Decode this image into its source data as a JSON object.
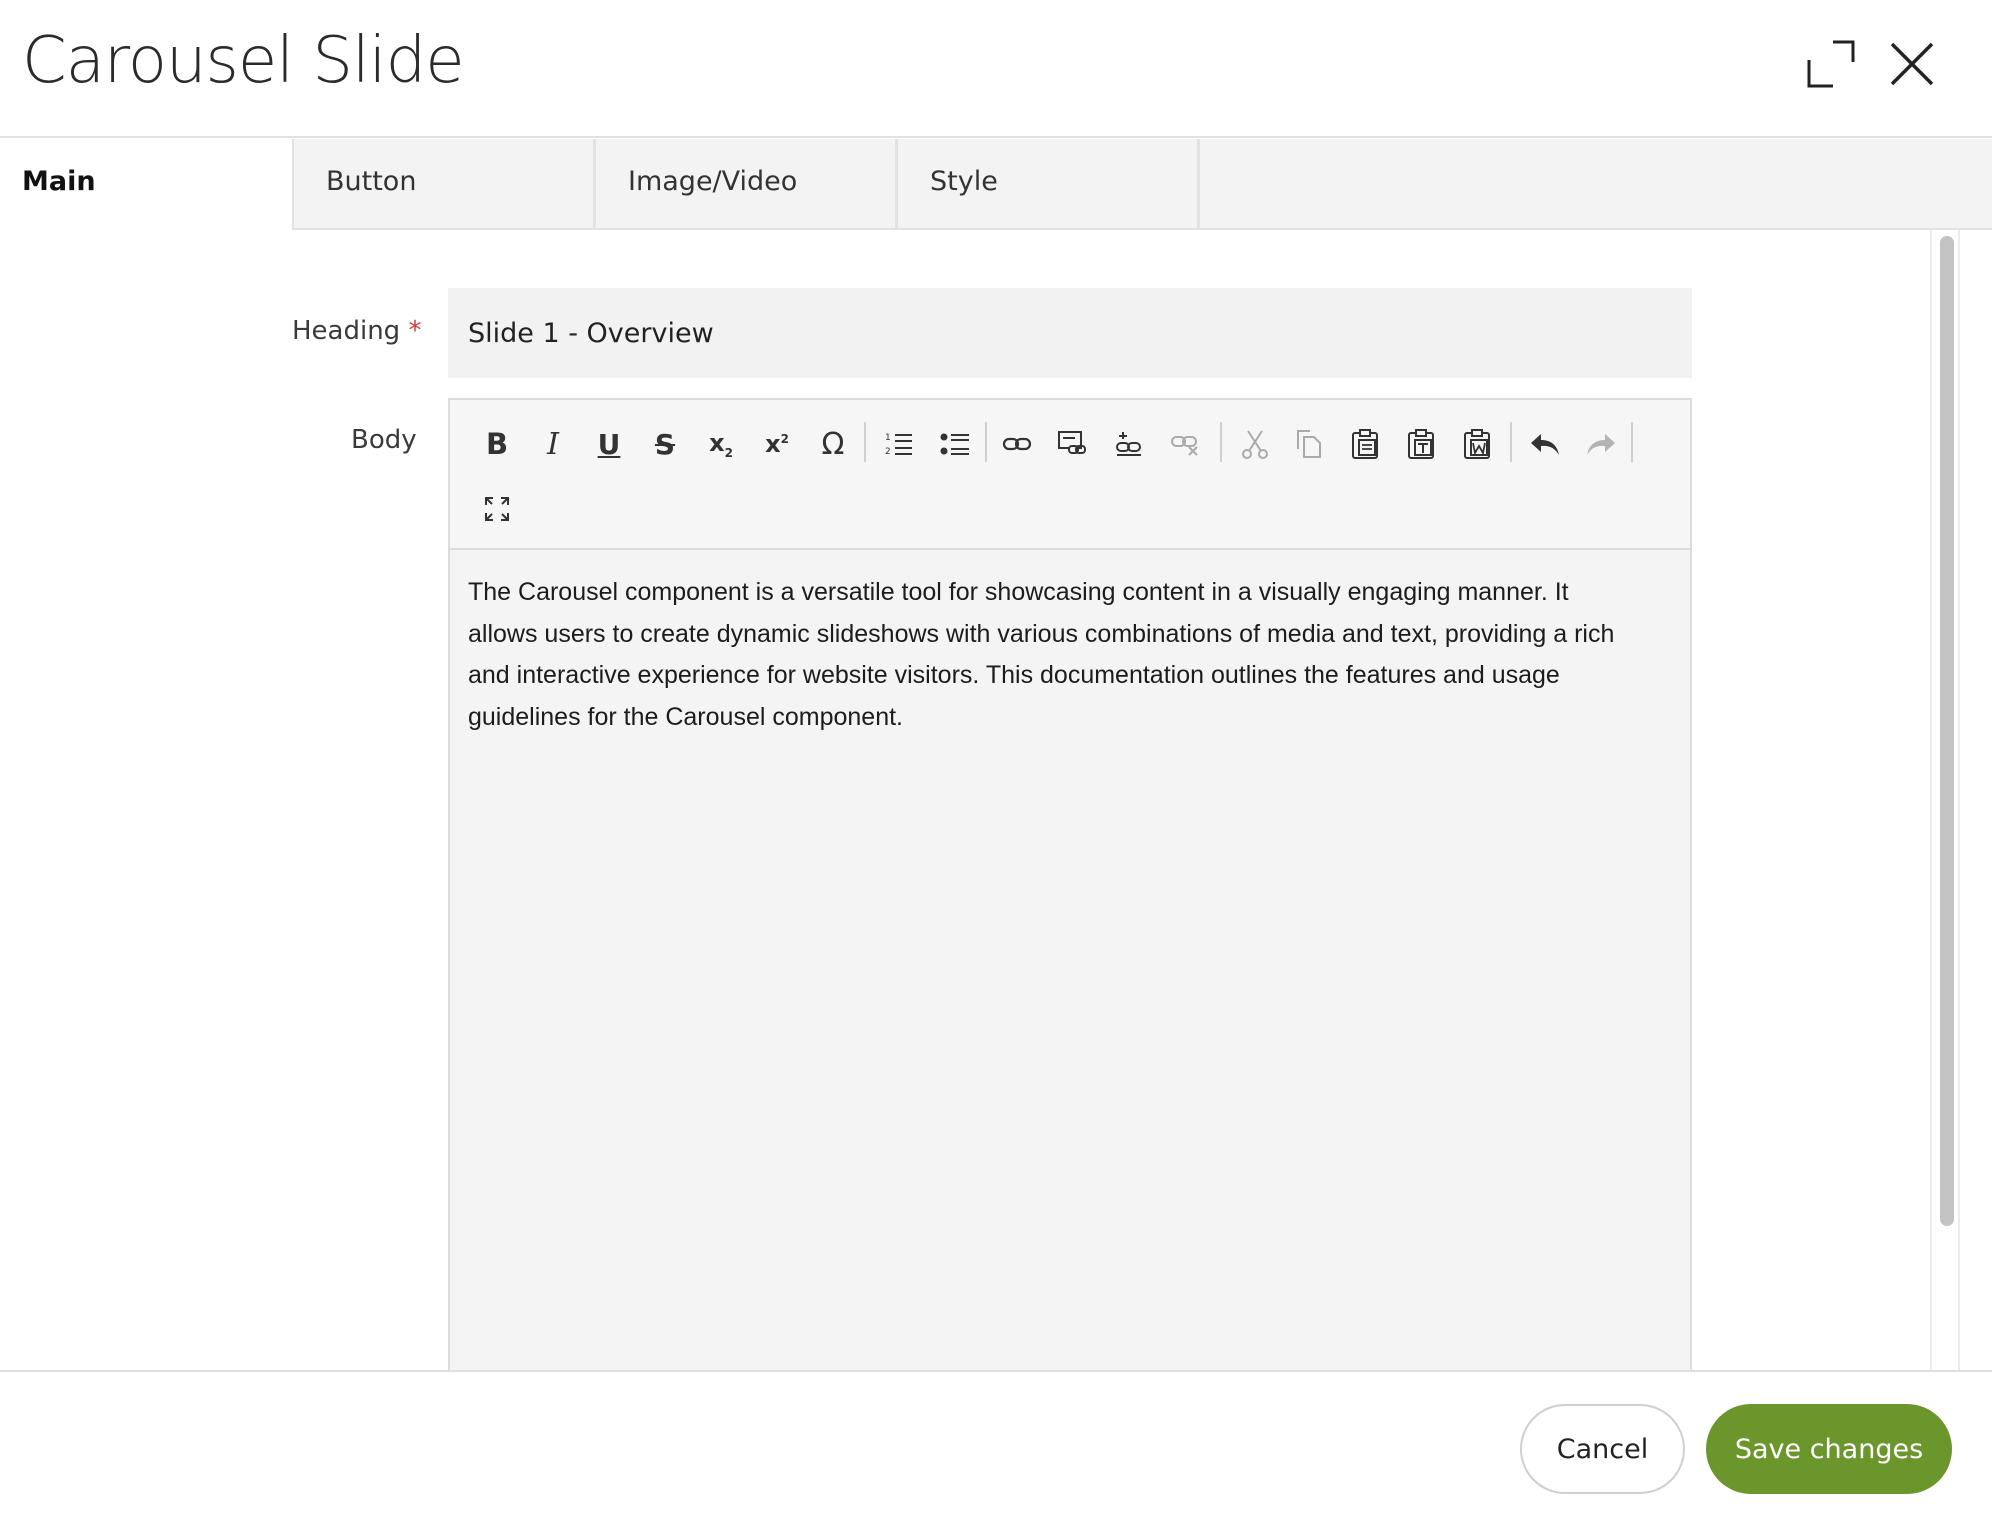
{
  "dialog": {
    "title": "Carousel Slide",
    "expand_icon": "expand-icon",
    "close_icon": "close-icon"
  },
  "tabs": [
    {
      "label": "Main",
      "active": true
    },
    {
      "label": "Button",
      "active": false
    },
    {
      "label": "Image/Video",
      "active": false
    },
    {
      "label": "Style",
      "active": false
    }
  ],
  "form": {
    "heading_label": "Heading",
    "required_marker": "*",
    "heading_value": "Slide 1 - Overview",
    "body_label": "Body",
    "body_text": "The Carousel component is a versatile tool for showcasing content in a visually engaging manner. It allows users to create dynamic slideshows with various combinations of media and text, providing a rich and interactive experience for website visitors. This documentation outlines the features and usage guidelines for the Carousel component."
  },
  "toolbar": {
    "buttons": [
      "bold-icon",
      "italic-icon",
      "underline-icon",
      "strikethrough-icon",
      "subscript-icon",
      "superscript-icon",
      "special-character-icon",
      "numbered-list-icon",
      "bulleted-list-icon",
      "link-icon",
      "anchor-icon",
      "unlink-icon",
      "cut-icon",
      "copy-icon",
      "paste-icon",
      "paste-text-icon",
      "paste-word-icon",
      "undo-icon",
      "redo-icon",
      "maximize-icon"
    ],
    "bold": "B",
    "italic": "I",
    "underline": "U",
    "strike": "S",
    "sub": "x",
    "sub_mark": "2",
    "sup": "x",
    "sup_mark": "2",
    "omega": "Ω"
  },
  "footer": {
    "cancel_label": "Cancel",
    "save_label": "Save changes"
  },
  "colors": {
    "accent": "#6b962c",
    "required": "#d43a3a"
  }
}
